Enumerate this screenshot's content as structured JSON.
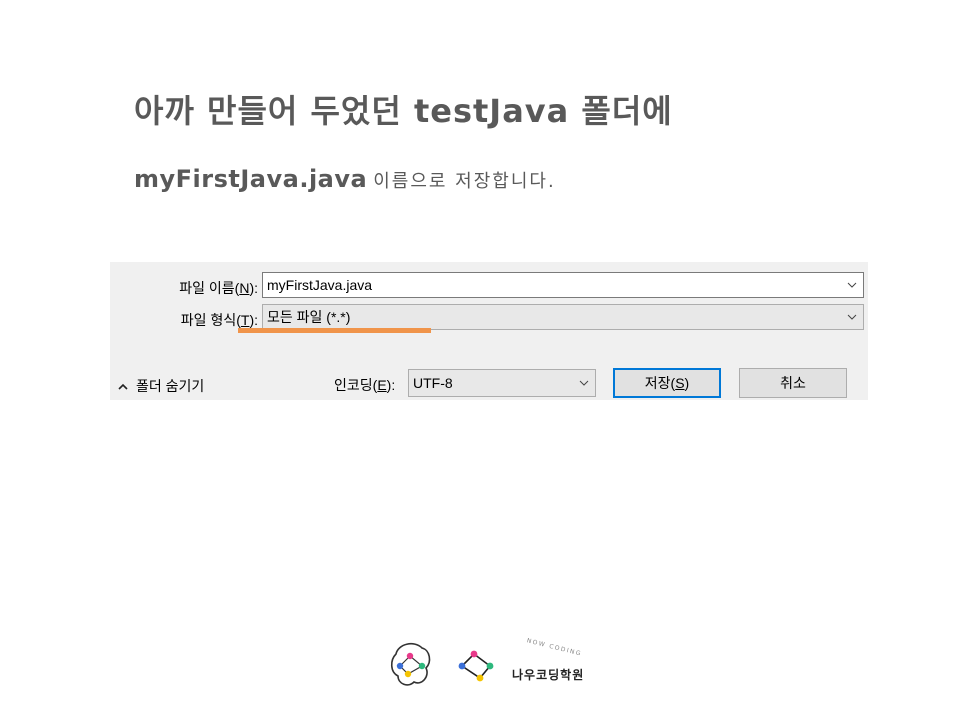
{
  "slide": {
    "heading": "아까 만들어 두었던 testJava 폴더에",
    "sub_filename": "myFirstJava.java",
    "sub_rest": "이름으로 저장합니다."
  },
  "dialog": {
    "filename_label_pre": "파일 이름(",
    "filename_label_key": "N",
    "filename_label_post": "):",
    "filename_value": "myFirstJava.java",
    "filetype_label_pre": "파일 형식(",
    "filetype_label_key": "T",
    "filetype_label_post": "):",
    "filetype_value": "모든 파일 (*.*)",
    "folder_toggle_label": "폴더 숨기기",
    "encoding_label_pre": "인코딩(",
    "encoding_label_key": "E",
    "encoding_label_post": "):",
    "encoding_value": "UTF-8",
    "save_label_pre": "저장(",
    "save_label_key": "S",
    "save_label_post": ")",
    "cancel_label": "취소",
    "highlight_color": "#f0944a",
    "focus_color": "#0078d7"
  },
  "logo": {
    "brand_name": "나우코딩학원",
    "brand_sub": "NOW CODING"
  }
}
